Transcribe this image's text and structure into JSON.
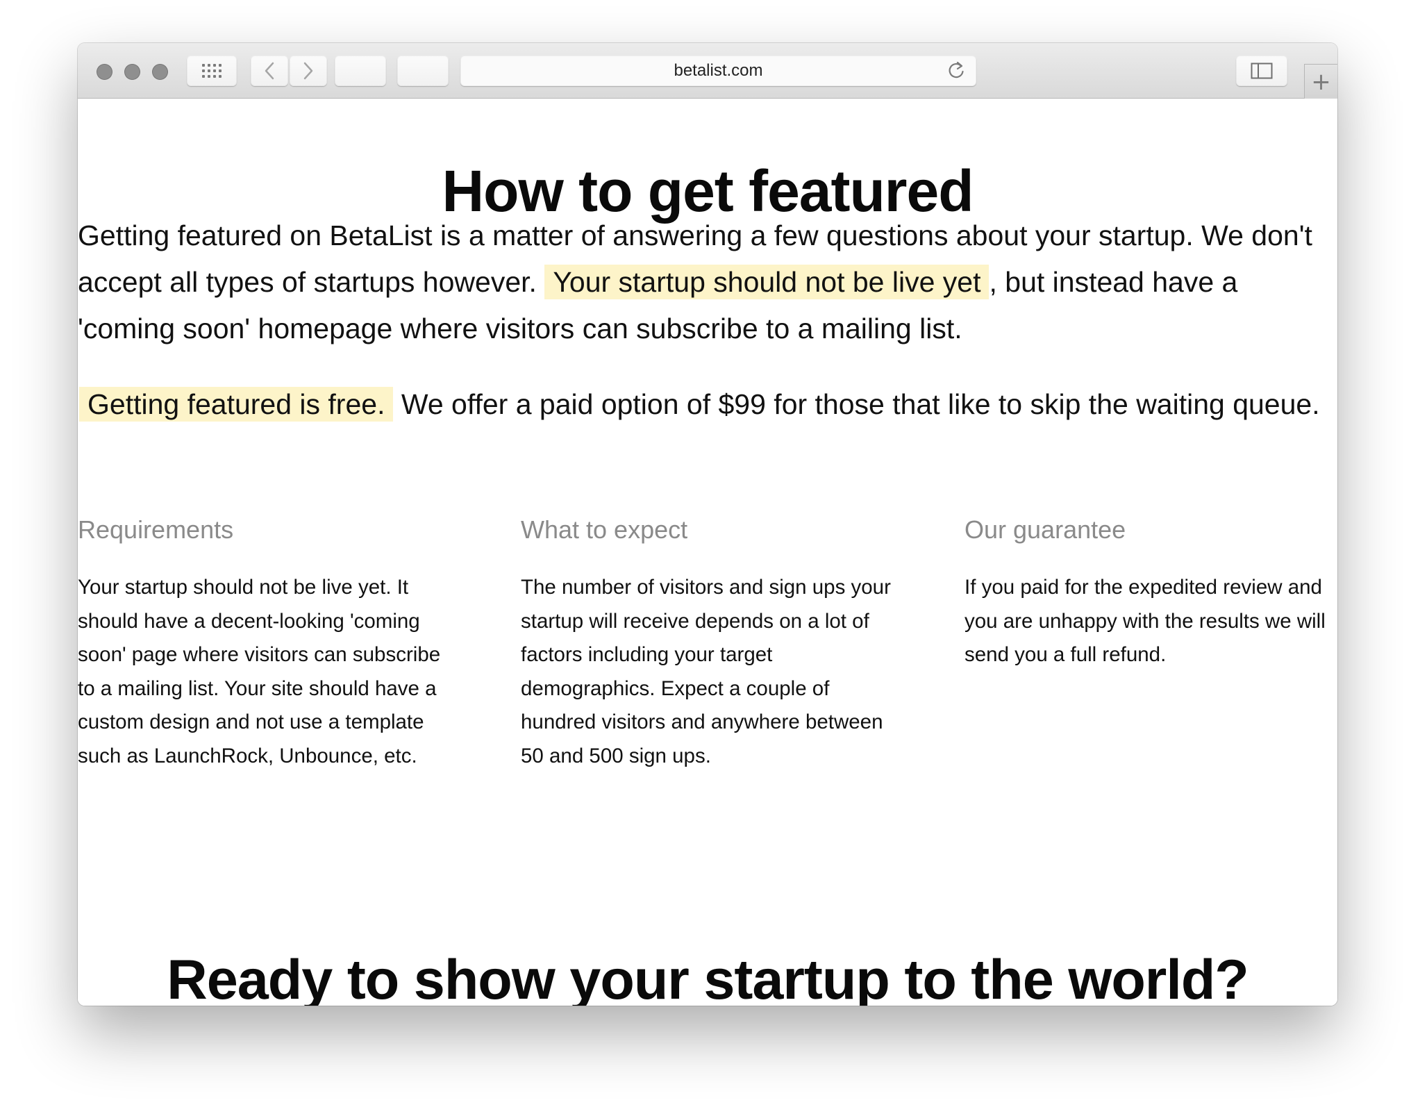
{
  "browser": {
    "url": "betalist.com",
    "traffic_lights": [
      "close",
      "minimize",
      "zoom"
    ],
    "new_tab_symbol": "+"
  },
  "page": {
    "title": "How to get featured",
    "intro": {
      "before": "Getting featured on BetaList is a matter of answering a few questions about your startup. We don't accept all types of startups however.",
      "highlight": "Your startup should not be live yet",
      "after": ", but instead have a 'coming soon' homepage where visitors can subscribe to a mailing list."
    },
    "pricing": {
      "highlight": "Getting featured is free.",
      "after": "We offer a paid option of $99 for those that like to skip the waiting queue."
    },
    "columns": [
      {
        "heading": "Requirements",
        "body": "Your startup should not be live yet. It should have a decent-looking 'coming soon' page where visitors can subscribe to a mailing list. Your site should have a custom design and not use a template such as LaunchRock, Unbounce, etc."
      },
      {
        "heading": "What to expect",
        "body": "The number of visitors and sign ups your startup will receive depends on a lot of factors including your target demographics. Expect a couple of hundred visitors and anywhere between 50 and 500 sign ups."
      },
      {
        "heading": "Our guarantee",
        "body": "If you paid for the expedited review and you are unhappy with the results we will send you a full refund."
      }
    ],
    "cta": "Ready to show your startup to the world?"
  },
  "colors": {
    "highlight": "#fdf4c9",
    "heading_gray": "#8a8a8a",
    "text": "#111111"
  }
}
